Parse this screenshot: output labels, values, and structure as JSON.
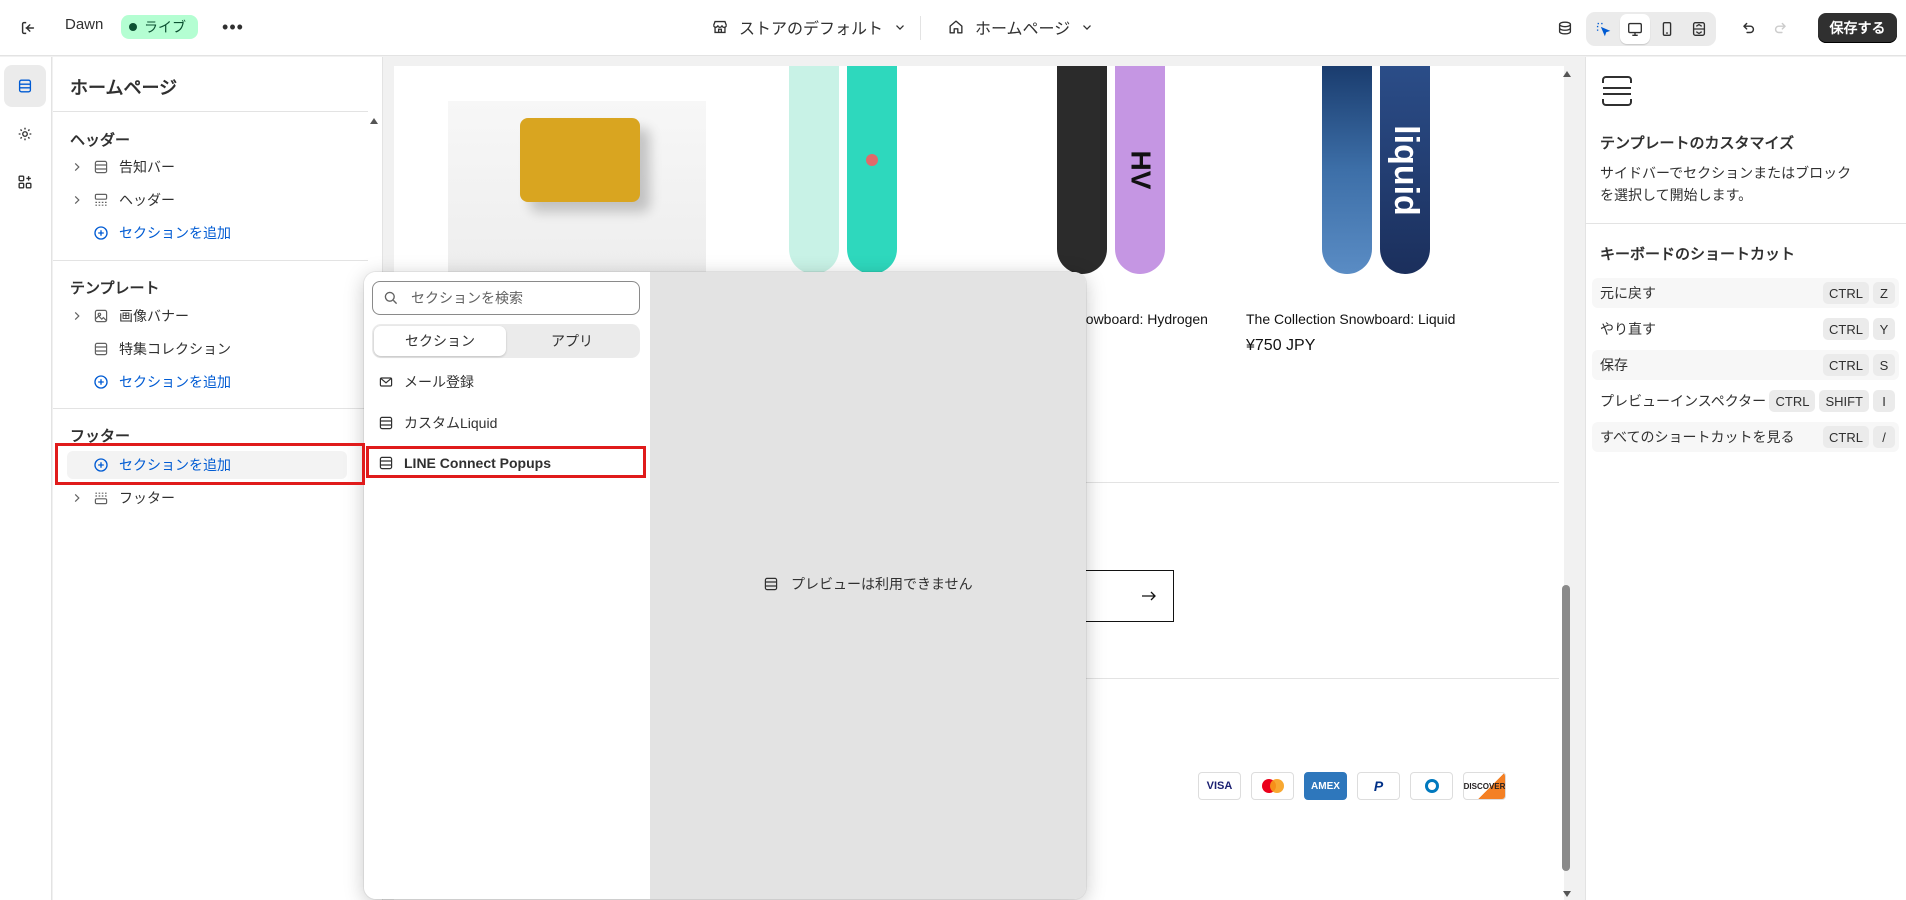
{
  "topbar": {
    "theme_name": "Dawn",
    "status_badge": "ライブ",
    "store_select": "ストアのデフォルト",
    "page_select": "ホームページ",
    "save_label": "保存する"
  },
  "sidebar": {
    "title": "ホームページ",
    "header_group": {
      "title": "ヘッダー",
      "items": [
        "告知バー",
        "ヘッダー"
      ],
      "add_label": "セクションを追加"
    },
    "template_group": {
      "title": "テンプレート",
      "items": [
        "画像バナー",
        "特集コレクション"
      ],
      "add_label": "セクションを追加"
    },
    "footer_group": {
      "title": "フッター",
      "add_label": "セクションを追加",
      "items": [
        "フッター"
      ]
    }
  },
  "preview": {
    "product_hydrogen": "nowboard: Hydrogen",
    "product_liquid": "The Collection Snowboard: Liquid",
    "price_liquid": "¥750 JPY",
    "payment_icons": [
      "VISA",
      "Mastercard",
      "AMEX",
      "PayPal",
      "Diners",
      "DISCOVER"
    ],
    "board_text": "liquid",
    "board_text_2": "HV"
  },
  "picker": {
    "search_placeholder": "セクションを検索",
    "tabs": [
      "セクション",
      "アプリ"
    ],
    "items": [
      "メール登録",
      "カスタムLiquid",
      "LINE Connect Popups"
    ],
    "preview_unavailable": "プレビューは利用できません"
  },
  "rightpanel": {
    "title": "テンプレートのカスタマイズ",
    "description": "サイドバーでセクションまたはブロックを選択して開始します。",
    "keyboard_title": "キーボードのショートカット",
    "shortcuts": [
      {
        "label": "元に戻す",
        "keys": [
          "CTRL",
          "Z"
        ]
      },
      {
        "label": "やり直す",
        "keys": [
          "CTRL",
          "Y"
        ]
      },
      {
        "label": "保存",
        "keys": [
          "CTRL",
          "S"
        ]
      },
      {
        "label": "プレビューインスペクター",
        "keys": [
          "CTRL",
          "SHIFT",
          "I"
        ]
      },
      {
        "label": "すべてのショートカットを見る",
        "keys": [
          "CTRL",
          "/"
        ]
      }
    ]
  },
  "colors": {
    "accent": "#005bd3",
    "live_badge_bg": "#b4fed2",
    "highlight_red": "#e01b1b",
    "save_button": "#303030"
  }
}
